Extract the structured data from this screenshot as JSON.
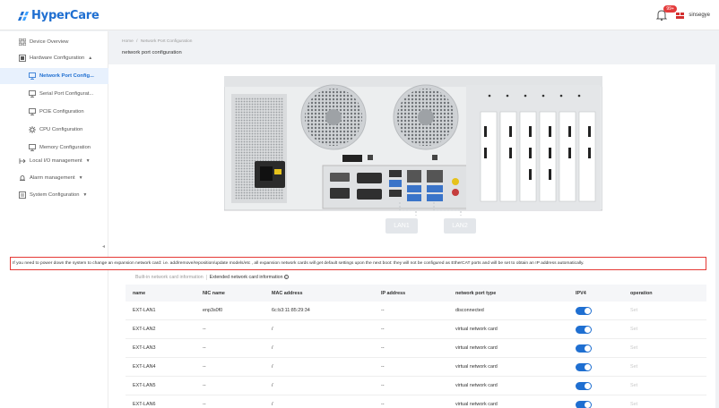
{
  "app": {
    "name": "HyperCare"
  },
  "header": {
    "notification_count": "99+",
    "user_name": "sinsegye"
  },
  "sidebar": {
    "items": [
      {
        "label": "Device Overview",
        "icon": "grid-icon",
        "level": "top"
      },
      {
        "label": "Hardware Configuration",
        "icon": "hardware-icon",
        "level": "top",
        "expanded": true
      },
      {
        "label": "Network Port Config...",
        "icon": "network-port-icon",
        "level": "sub",
        "active": true
      },
      {
        "label": "Serial Port Configurat...",
        "icon": "serial-port-icon",
        "level": "sub"
      },
      {
        "label": "PCIE Configuration",
        "icon": "pcie-icon",
        "level": "sub"
      },
      {
        "label": "CPU Configuration",
        "icon": "cpu-icon",
        "level": "sub"
      },
      {
        "label": "Memory Configuration",
        "icon": "memory-icon",
        "level": "sub"
      },
      {
        "label": "Local I/O management",
        "icon": "io-icon",
        "level": "top"
      },
      {
        "label": "Alarm management",
        "icon": "alarm-icon",
        "level": "top"
      },
      {
        "label": "System Configuration",
        "icon": "system-icon",
        "level": "top"
      }
    ]
  },
  "breadcrumb": {
    "home": "Home",
    "separator": "/",
    "current": "Network Port Configuration"
  },
  "page_title": "network port configuration",
  "lan_labels": [
    "LAN1",
    "LAN2"
  ],
  "warning_text": "If you need to power down the system to change an expansion network card: i.e. add/remove/reposition/update models/etc , all expansion network cards will get default settings upon the next boot: they will not be configured as EtherCAT ports and will be set to obtain an IP address automatically.",
  "tabs": [
    {
      "label": "Built-in network card information",
      "active": false
    },
    {
      "label": "Extended network card information",
      "active": true,
      "icon": "info-icon"
    }
  ],
  "table": {
    "columns": [
      "name",
      "NIC name",
      "MAC address",
      "IP address",
      "network port type",
      "IPV4",
      "operation"
    ],
    "rows": [
      {
        "name": "EXT-LAN1",
        "nic": "enp3s0f0",
        "mac": "6c:b3:11:85:29:34",
        "ip": "--",
        "type": "disconnected",
        "ipv4": true,
        "op": "Set"
      },
      {
        "name": "EXT-LAN2",
        "nic": "--",
        "mac": "/",
        "ip": "--",
        "type": "virtual network card",
        "ipv4": true,
        "op": "Set"
      },
      {
        "name": "EXT-LAN3",
        "nic": "--",
        "mac": "/",
        "ip": "--",
        "type": "virtual network card",
        "ipv4": true,
        "op": "Set"
      },
      {
        "name": "EXT-LAN4",
        "nic": "--",
        "mac": "/",
        "ip": "--",
        "type": "virtual network card",
        "ipv4": true,
        "op": "Set"
      },
      {
        "name": "EXT-LAN5",
        "nic": "--",
        "mac": "/",
        "ip": "--",
        "type": "virtual network card",
        "ipv4": true,
        "op": "Set"
      },
      {
        "name": "EXT-LAN6",
        "nic": "--",
        "mac": "/",
        "ip": "--",
        "type": "virtual network card",
        "ipv4": true,
        "op": "Set"
      }
    ]
  },
  "colors": {
    "accent": "#1f6fd1",
    "warning_border": "#e53935",
    "active_bg": "#e8f1fd"
  }
}
